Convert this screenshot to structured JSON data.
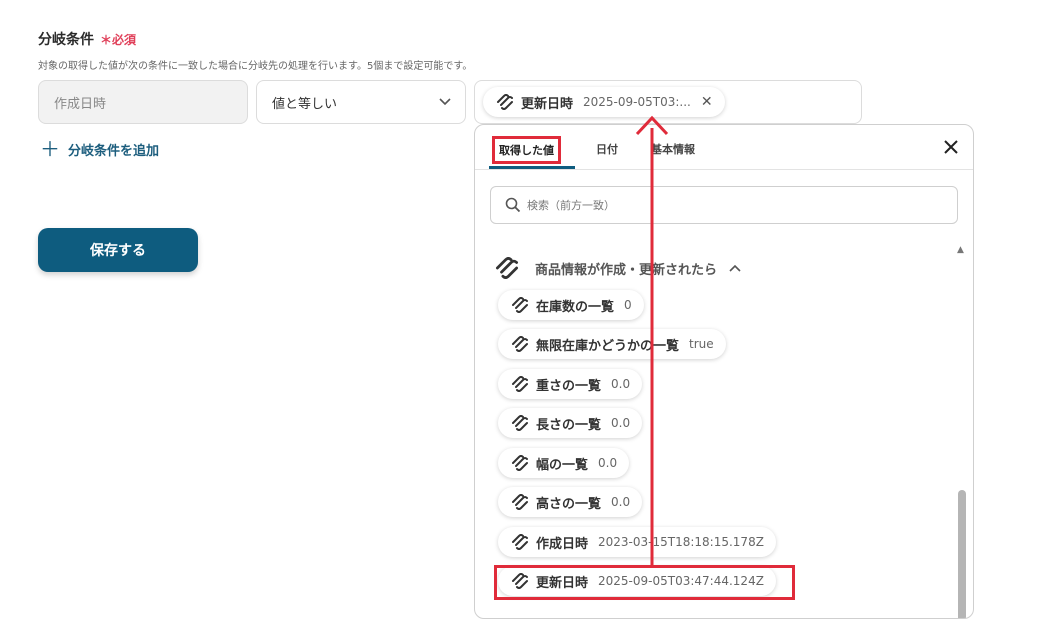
{
  "section": {
    "title": "分岐条件",
    "required_mark": "＊",
    "required_label": "必須",
    "description": "対象の取得した値が次の条件に一致した場合に分岐先の処理を行います。5個まで設定可能です。"
  },
  "condition": {
    "field_left": "作成日時",
    "operator": "値と等しい",
    "value_chip": {
      "label": "更新日時",
      "value": "2025-09-05T03:..."
    }
  },
  "add_condition_label": "分岐条件を追加",
  "save_label": "保存する",
  "panel": {
    "tabs": [
      "取得した値",
      "日付",
      "基本情報"
    ],
    "search_placeholder": "検索（前方一致）",
    "group_title": "商品情報が作成・更新されたら",
    "items": [
      {
        "label": "在庫数の一覧",
        "value": "0"
      },
      {
        "label": "無限在庫かどうかの一覧",
        "value": "true"
      },
      {
        "label": "重さの一覧",
        "value": "0.0"
      },
      {
        "label": "長さの一覧",
        "value": "0.0"
      },
      {
        "label": "幅の一覧",
        "value": "0.0"
      },
      {
        "label": "高さの一覧",
        "value": "0.0"
      },
      {
        "label": "作成日時",
        "value": "2023-03-15T18:18:15.178Z"
      },
      {
        "label": "更新日時",
        "value": "2025-09-05T03:47:44.124Z"
      }
    ]
  },
  "colors": {
    "accent": "#0e5c7f",
    "highlight": "#e02b3a",
    "required": "#e0405a"
  },
  "icons": {
    "service": "squarespace-icon",
    "search": "search-icon",
    "close": "close-icon",
    "chevron": "chevron-down-icon"
  }
}
